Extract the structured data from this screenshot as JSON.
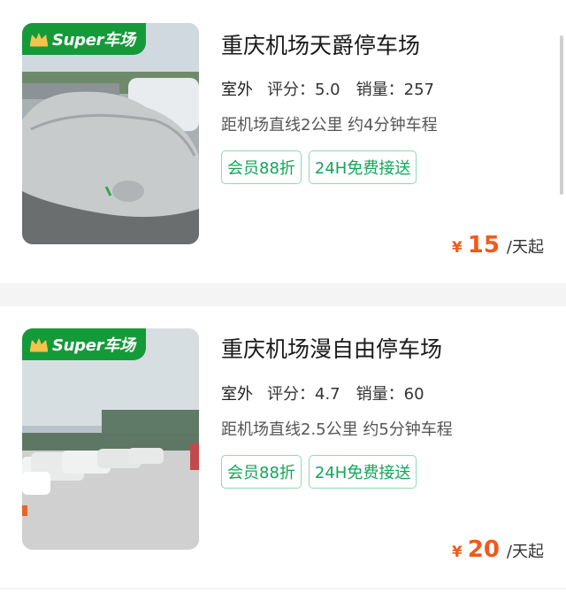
{
  "badge": {
    "text": "Super车场"
  },
  "lots": [
    {
      "name": "重庆机场天爵停车场",
      "type": "室外",
      "rating_label": "评分：5.0",
      "sales_label": "销量：257",
      "distance": "距机场直线2公里 约4分钟车程",
      "tags": [
        "会员88折",
        "24H免费接送"
      ],
      "currency": "¥",
      "price": "15",
      "unit": "/天起",
      "photo_icon": "covered-car-photo"
    },
    {
      "name": "重庆机场漫自由停车场",
      "type": "室外",
      "rating_label": "评分：4.7",
      "sales_label": "销量：60",
      "distance": "距机场直线2.5公里 约5分钟车程",
      "tags": [
        "会员88折",
        "24H免费接送"
      ],
      "currency": "¥",
      "price": "20",
      "unit": "/天起",
      "photo_icon": "parking-lot-photo"
    }
  ],
  "colors": {
    "badge_green": "#159a3a",
    "tag_green": "#13a55a",
    "price_orange": "#f05a1a"
  }
}
